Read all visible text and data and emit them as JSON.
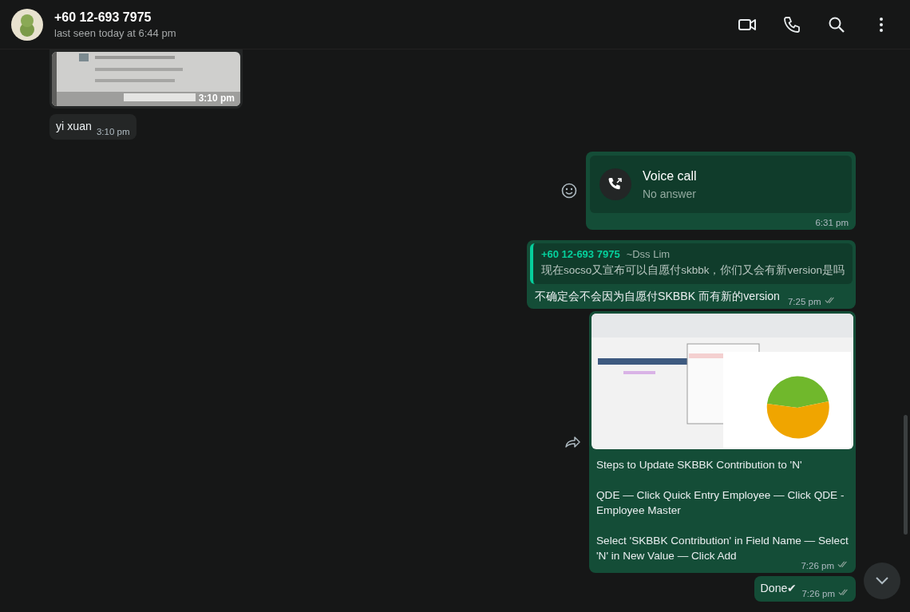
{
  "header": {
    "contact_name": "+60 12-693 7975",
    "status": "last seen today at 6:44 pm"
  },
  "messages": [
    {
      "outgoing": false,
      "time": "3:10 pm"
    },
    {
      "kind": "text",
      "outgoing": false,
      "text": "yi xuan",
      "time": "3:10 pm"
    },
    {
      "kind": "call",
      "outgoing": true,
      "title": "Voice call",
      "subtitle": "No answer",
      "time": "6:31 pm"
    },
    {
      "kind": "reply",
      "outgoing": true,
      "quote_author": "+60 12-693 7975",
      "quote_name": "~Dss Lim",
      "quote_text": "现在socso又宣布可以自愿付skbbk，你们又会有新version是吗",
      "text": "不确定会不会因为自愿付SKBBK 而有新的version",
      "time": "7:25 pm",
      "read": false
    },
    {
      "kind": "image_caption",
      "outgoing": true,
      "caption": [
        "Steps to Update SKBBK Contribution to 'N'",
        "QDE — Click Quick Entry Employee — Click QDE - Employee Master",
        "Select 'SKBBK Contribution' in Field Name — Select 'N' in New Value — Click Add"
      ],
      "time": "7:26 pm",
      "read": false
    },
    {
      "kind": "text",
      "outgoing": true,
      "text": "Done✔",
      "time": "7:26 pm",
      "read": false
    }
  ]
}
